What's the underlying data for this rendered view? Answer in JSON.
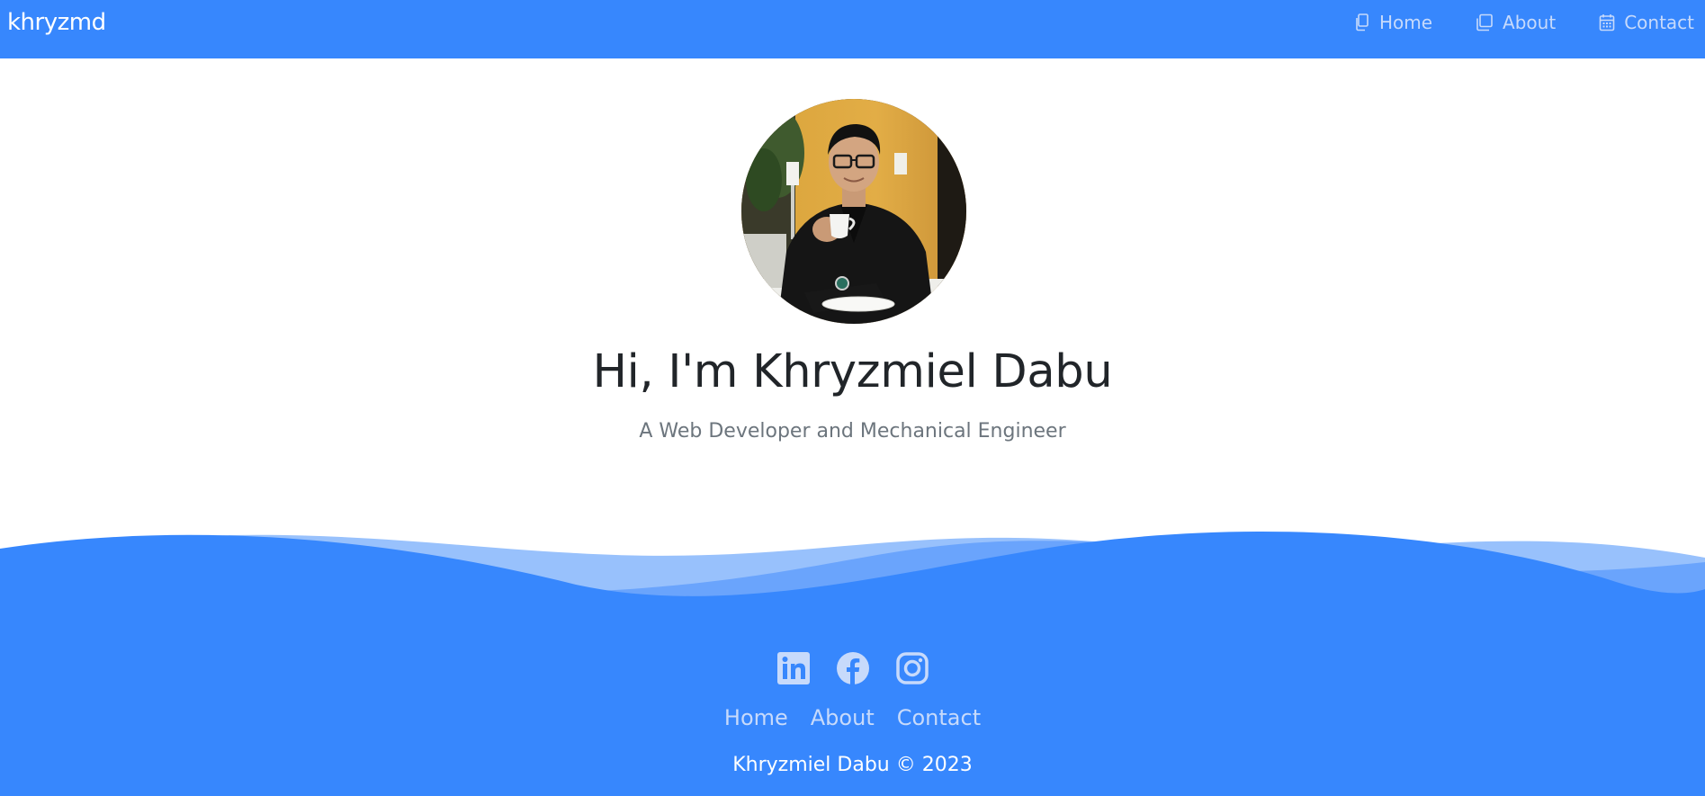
{
  "header": {
    "brand": "khryzmd",
    "nav": [
      {
        "label": "Home",
        "icon": "files-icon"
      },
      {
        "label": "About",
        "icon": "copy-icon"
      },
      {
        "label": "Contact",
        "icon": "calendar-icon"
      }
    ]
  },
  "hero": {
    "title": "Hi, I'm Khryzmiel Dabu",
    "subtitle": "A Web Developer and Mechanical Engineer"
  },
  "footer": {
    "social": [
      {
        "name": "LinkedIn",
        "icon": "linkedin-icon"
      },
      {
        "name": "Facebook",
        "icon": "facebook-icon"
      },
      {
        "name": "Instagram",
        "icon": "instagram-icon"
      }
    ],
    "nav": [
      "Home",
      "About",
      "Contact"
    ],
    "copyright": "Khryzmiel Dabu © 2023"
  },
  "colors": {
    "primary": "#3787fd",
    "nav_text": "#c7dafb",
    "title_text": "#212529",
    "subtitle_text": "#6c757d",
    "wave_light": "#98c1fc",
    "wave_mid": "#6aa4fc"
  }
}
